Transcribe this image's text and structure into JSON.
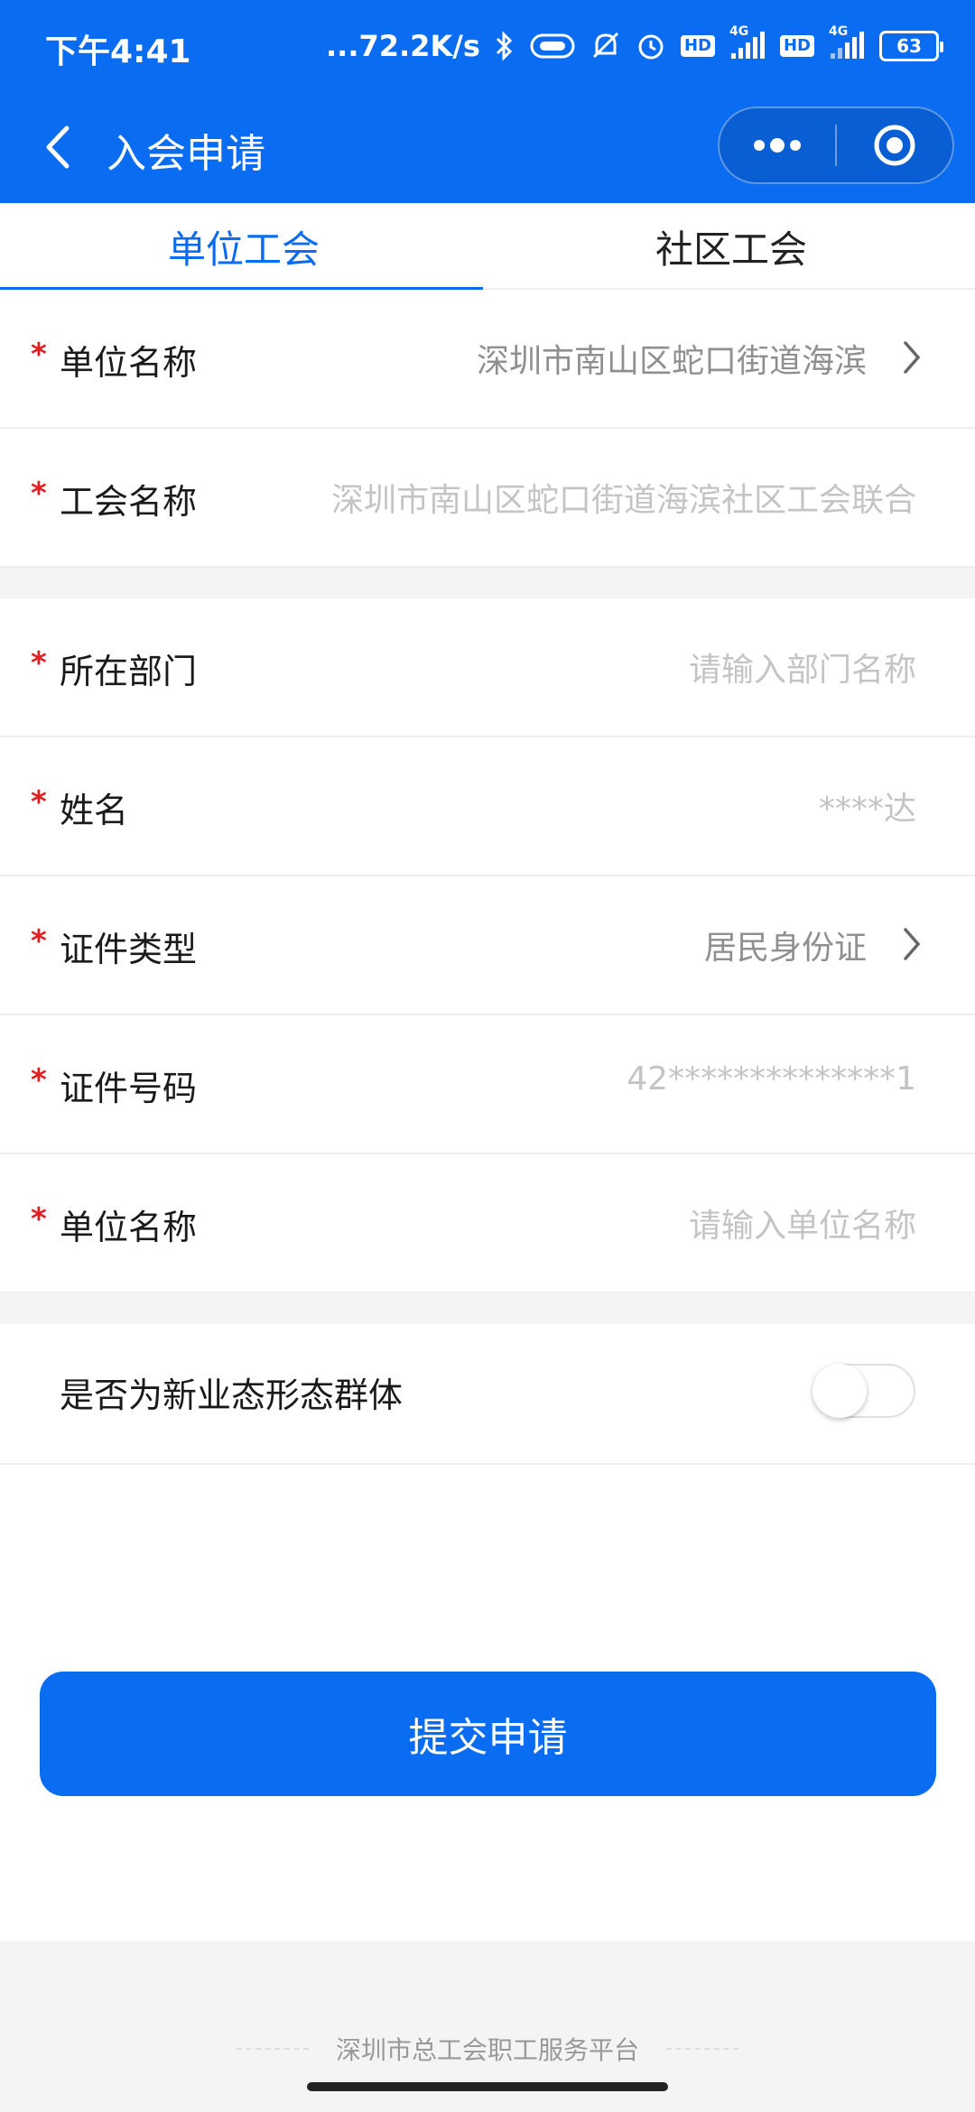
{
  "status_bar": {
    "time": "下午4:41",
    "network_speed": "...72.2K/s",
    "hd1": "HD",
    "net1": "4G",
    "hd2": "HD",
    "net2": "4G",
    "battery": "63"
  },
  "nav": {
    "title": "入会申请",
    "more_icon": "more-dots-icon",
    "close_icon": "target-close-icon"
  },
  "tabs": [
    {
      "label": "单位工会",
      "active": true
    },
    {
      "label": "社区工会",
      "active": false
    }
  ],
  "form": {
    "org_name": {
      "label": "单位名称",
      "value": "深圳市南山区蛇口街道海滨"
    },
    "union_name": {
      "label": "工会名称",
      "value": "深圳市南山区蛇口街道海滨社区工会联合"
    },
    "department": {
      "label": "所在部门",
      "placeholder": "请输入部门名称"
    },
    "name": {
      "label": "姓名",
      "value": "****达"
    },
    "id_type": {
      "label": "证件类型",
      "value": "居民身份证"
    },
    "id_number": {
      "label": "证件号码",
      "value": "42**************1"
    },
    "org_name2": {
      "label": "单位名称",
      "placeholder": "请输入单位名称"
    },
    "new_business": {
      "label": "是否为新业态形态群体",
      "enabled": false
    }
  },
  "required_mark": "*",
  "submit_label": "提交申请",
  "footer_text": "深圳市总工会职工服务平台",
  "colors": {
    "primary": "#0a6cf0",
    "required": "#e02020",
    "placeholder": "#c4c4c4"
  }
}
